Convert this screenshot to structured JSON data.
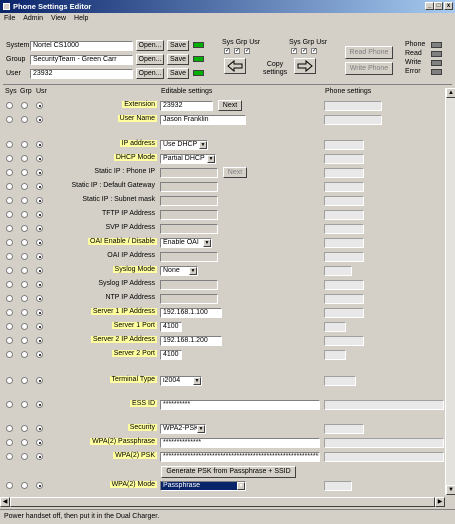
{
  "window": {
    "title": "Phone Settings Editor",
    "controls": [
      "_",
      "□",
      "x"
    ]
  },
  "menu": [
    "File",
    "Admin",
    "View",
    "Help"
  ],
  "top": {
    "system_label": "System",
    "system_value": "Nortel CS1000",
    "group_label": "Group",
    "group_value": "SecurityTeam - Green Carr",
    "user_label": "User",
    "user_value": "23932",
    "open_label": "Open...",
    "save_label": "Save",
    "sgu_header_left": "Sys Grp Usr",
    "sgu_header_right": "Sys Grp Usr",
    "copy_label": "Copy settings",
    "read_phone": "Read Phone",
    "write_phone": "Write Phone",
    "status_leds": [
      {
        "label": "Phone",
        "state": "off"
      },
      {
        "label": "Read",
        "state": "off"
      },
      {
        "label": "Write",
        "state": "off"
      },
      {
        "label": "Error",
        "state": "off"
      }
    ],
    "led_color_on": "#00b000"
  },
  "headers": {
    "sys": "Sys",
    "grp": "Grp",
    "usr": "Usr",
    "editable": "Editable settings",
    "phone": "Phone settings"
  },
  "rows": [
    {
      "label": "Extension",
      "value": "23932",
      "kind": "text",
      "button": "Next",
      "highlight": true
    },
    {
      "label": "User Name",
      "value": "Jason Franklin",
      "kind": "text",
      "highlight": true
    },
    {
      "label": "IP address",
      "value": "Use DHCP",
      "kind": "dropdown",
      "highlight": true
    },
    {
      "label": "DHCP Mode",
      "value": "Partial DHCP",
      "kind": "dropdown",
      "highlight": true
    },
    {
      "label": "Static IP : Phone IP",
      "value": "",
      "kind": "disabled",
      "button": "Next",
      "highlight": false
    },
    {
      "label": "Static IP : Default Gateway",
      "value": "",
      "kind": "disabled",
      "highlight": false
    },
    {
      "label": "Static IP : Subnet mask",
      "value": "",
      "kind": "disabled",
      "highlight": false
    },
    {
      "label": "TFTP IP Address",
      "value": "",
      "kind": "disabled",
      "highlight": false
    },
    {
      "label": "SVP IP Address",
      "value": "",
      "kind": "disabled",
      "highlight": false
    },
    {
      "label": "OAI Enable / Disable",
      "value": "Enable OAI",
      "kind": "dropdown",
      "highlight": true
    },
    {
      "label": "OAI IP Address",
      "value": "",
      "kind": "disabled",
      "highlight": false
    },
    {
      "label": "Syslog Mode",
      "value": "None",
      "kind": "dropdown",
      "highlight": true
    },
    {
      "label": "Syslog IP Address",
      "value": "",
      "kind": "disabled",
      "highlight": false
    },
    {
      "label": "NTP IP Address",
      "value": "",
      "kind": "disabled",
      "highlight": false
    },
    {
      "label": "Server 1 IP Address",
      "value": "192.168.1.100",
      "kind": "text",
      "highlight": true
    },
    {
      "label": "Server 1 Port",
      "value": "4100",
      "kind": "text",
      "highlight": true
    },
    {
      "label": "Server 2 IP Address",
      "value": "192.168.1.200",
      "kind": "text",
      "highlight": true
    },
    {
      "label": "Server 2 Port",
      "value": "4100",
      "kind": "text",
      "highlight": true
    },
    {
      "label": "Terminal Type",
      "value": "i2004",
      "kind": "dropdown",
      "highlight": true
    },
    {
      "label": "ESS ID",
      "value": "**********",
      "kind": "text",
      "highlight": true
    },
    {
      "label": "Security",
      "value": "WPA2-PSK",
      "kind": "dropdown",
      "highlight": true
    },
    {
      "label": "WPA(2) Passphrase",
      "value": "**************",
      "kind": "text",
      "highlight": true
    },
    {
      "label": "WPA(2) PSK",
      "value": "************************************************************",
      "kind": "text",
      "highlight": true
    },
    {
      "label": "WPA(2) Mode",
      "value": "Passphrase",
      "kind": "dropdown",
      "highlight": true,
      "selected": true
    }
  ],
  "generate_button": "Generate PSK from Passphrase + SSID",
  "status_text": "Power handset off, then put it in the Dual Charger."
}
